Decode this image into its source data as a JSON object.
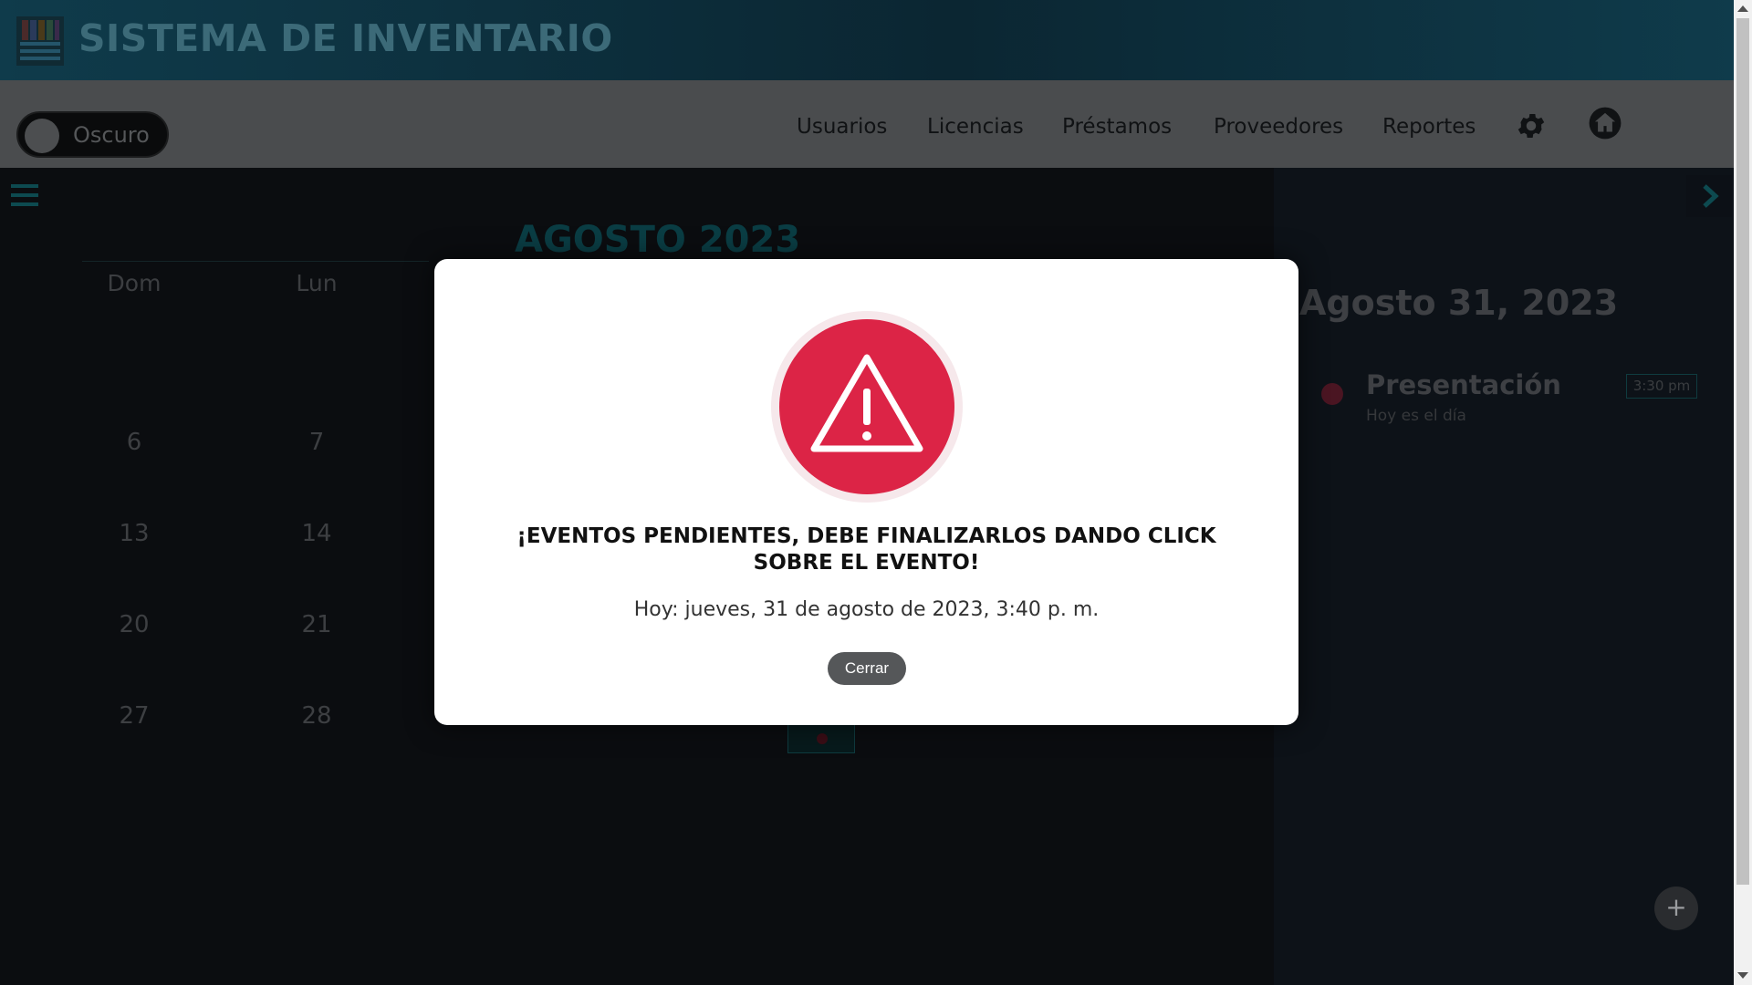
{
  "header": {
    "title": "SISTEMA DE INVENTARIO"
  },
  "navbar": {
    "theme_toggle_label": "Oscuro",
    "links": [
      "Usuarios",
      "Licencias",
      "Préstamos",
      "Proveedores",
      "Reportes"
    ],
    "icons": [
      "gear-icon",
      "home-icon"
    ]
  },
  "calendar": {
    "month_title": "AGOSTO 2023",
    "day_names": [
      "Dom",
      "Lun"
    ],
    "weeks": [
      [
        "6",
        "7"
      ],
      [
        "13",
        "14"
      ],
      [
        "20",
        "21"
      ],
      [
        "27",
        "28"
      ]
    ]
  },
  "side_panel": {
    "date": "Agosto 31, 2023",
    "event": {
      "title": "Presentación",
      "description": "Hoy es el día",
      "time": "3:30 pm"
    },
    "add_label": "+"
  },
  "modal": {
    "title": "¡EVENTOS PENDIENTES, DEBE FINALIZARLOS DANDO CLICK SOBRE EL EVENTO!",
    "text": "Hoy: jueves, 31 de agosto de 2023, 3:40 p. m.",
    "button_label": "Cerrar",
    "icon": "warning-icon",
    "accent_color": "#dc2446"
  }
}
